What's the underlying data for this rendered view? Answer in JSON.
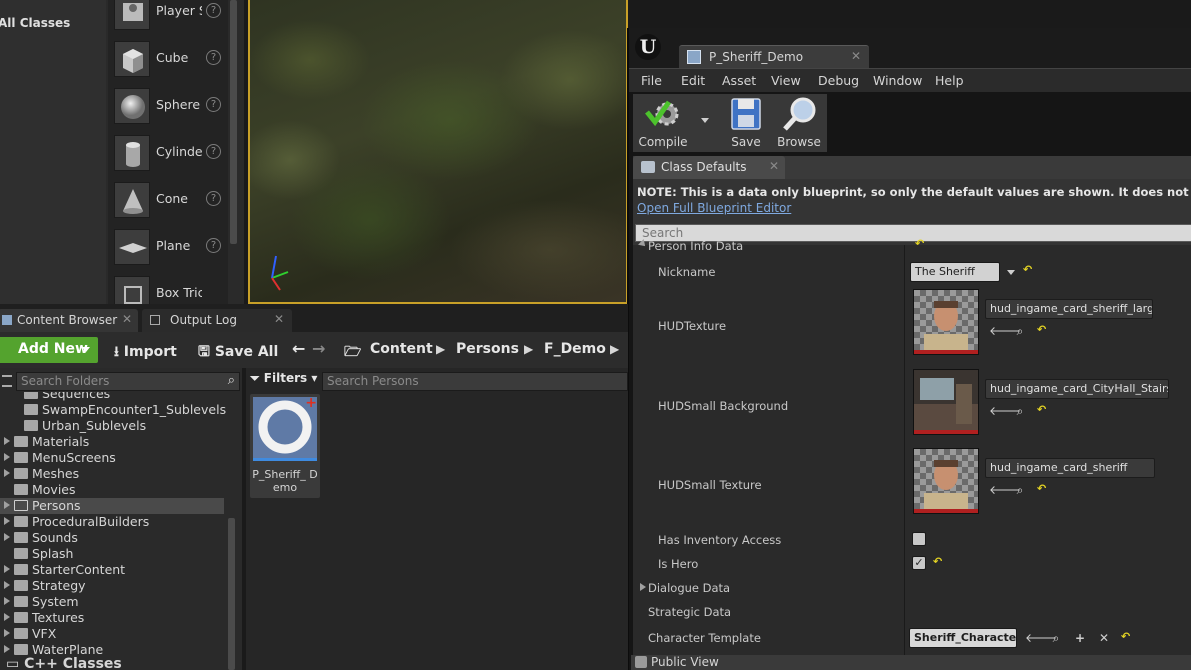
{
  "place_panel": {
    "category": "All Classes",
    "items": [
      {
        "label": "Player S",
        "icon": "player-start-icon"
      },
      {
        "label": "Cube",
        "icon": "cube-icon"
      },
      {
        "label": "Sphere",
        "icon": "sphere-icon"
      },
      {
        "label": "Cylinder",
        "icon": "cylinder-icon"
      },
      {
        "label": "Cone",
        "icon": "cone-icon"
      },
      {
        "label": "Plane",
        "icon": "plane-icon"
      },
      {
        "label": "Box Tric",
        "icon": "box-trigger-icon"
      }
    ],
    "help_glyph": "?"
  },
  "blueprint_editor": {
    "doc_tab": "P_Sheriff_Demo",
    "menu": [
      "File",
      "Edit",
      "Asset",
      "View",
      "Debug",
      "Window",
      "Help"
    ],
    "toolbar": {
      "compile": "Compile",
      "save": "Save",
      "browse": "Browse"
    },
    "class_defaults_tab": "Class Defaults",
    "note": "NOTE: This is a data only blueprint, so only the default values are shown.  It does not have any script or v",
    "open_full_editor": "Open Full Blueprint Editor",
    "search_placeholder": "Search",
    "properties": {
      "category": "Person Info Data",
      "nickname": {
        "label": "Nickname",
        "value": "The Sheriff"
      },
      "hud_texture": {
        "label": "HUDTexture",
        "asset": "hud_ingame_card_sheriff_large"
      },
      "hud_small_background": {
        "label": "HUDSmall Background",
        "asset": "hud_ingame_card_CityHall_Stairs"
      },
      "hud_small_texture": {
        "label": "HUDSmall Texture",
        "asset": "hud_ingame_card_sheriff"
      },
      "has_inventory_access": {
        "label": "Has Inventory Access",
        "checked": false
      },
      "is_hero": {
        "label": "Is Hero",
        "checked": true,
        "check_glyph": "✓"
      },
      "dialogue_data": "Dialogue Data",
      "strategic_data": "Strategic Data",
      "character_template": {
        "label": "Character Template",
        "value": "Sheriff_Character"
      },
      "public_view": "Public View"
    }
  },
  "content_browser": {
    "tabs": [
      "Content Browser",
      "Output Log"
    ],
    "toolbar": {
      "add_new": "Add New",
      "import": "Import",
      "save_all": "Save All"
    },
    "breadcrumb": [
      "Content",
      "Persons",
      "F_Demo"
    ],
    "folder_search_placeholder": "Search Folders",
    "filters": "Filters",
    "asset_search_placeholder": "Search Persons",
    "folders": [
      {
        "label": "Sequences",
        "expandable": false,
        "indent": 1
      },
      {
        "label": "SwampEncounter1_Sublevels",
        "expandable": false,
        "indent": 1
      },
      {
        "label": "Urban_Sublevels",
        "expandable": false,
        "indent": 1
      },
      {
        "label": "Materials",
        "expandable": true,
        "indent": 0
      },
      {
        "label": "MenuScreens",
        "expandable": true,
        "indent": 0
      },
      {
        "label": "Meshes",
        "expandable": true,
        "indent": 0
      },
      {
        "label": "Movies",
        "expandable": false,
        "indent": 0
      },
      {
        "label": "Persons",
        "expandable": true,
        "indent": 0,
        "selected": true
      },
      {
        "label": "ProceduralBuilders",
        "expandable": true,
        "indent": 0
      },
      {
        "label": "Sounds",
        "expandable": true,
        "indent": 0
      },
      {
        "label": "Splash",
        "expandable": false,
        "indent": 0
      },
      {
        "label": "StarterContent",
        "expandable": true,
        "indent": 0
      },
      {
        "label": "Strategy",
        "expandable": true,
        "indent": 0
      },
      {
        "label": "System",
        "expandable": true,
        "indent": 0
      },
      {
        "label": "Textures",
        "expandable": true,
        "indent": 0
      },
      {
        "label": "VFX",
        "expandable": true,
        "indent": 0
      },
      {
        "label": "WaterPlane",
        "expandable": true,
        "indent": 0
      }
    ],
    "asset": {
      "label": "P_Sheriff_ Demo"
    },
    "cpp_classes": "C++ Classes"
  },
  "colors": {
    "accent_green": "#54a32e",
    "selection": "#4a4a4a",
    "reset_yellow": "#e4d424",
    "viewport_border": "#c8a028"
  }
}
